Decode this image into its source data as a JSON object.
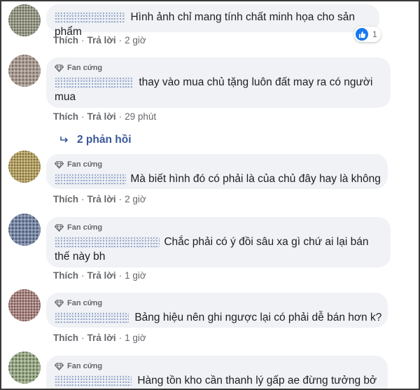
{
  "badge_label": "Fan cứng",
  "action_like": "Thích",
  "action_reply": "Trả lời",
  "separator": "·",
  "colors": {
    "link": "#385898",
    "bubble": "#f0f2f5",
    "meta": "#65676b",
    "like": "#1877f2"
  },
  "comments": [
    {
      "text": "Hình ảnh chỉ mang tính chất minh họa cho sản phẩm",
      "time": "2 giờ",
      "reaction_count": "1"
    },
    {
      "text": "thay vào mua chủ tặng luôn đất may ra có người mua",
      "time": "29 phút",
      "replies": "2 phản hồi"
    },
    {
      "text": "Mà biết hình đó có phải là của chủ đây hay là không",
      "time": "2 giờ"
    },
    {
      "text": "Chắc phải có ý đồi sâu xa gì chứ ai lại bán thế này bh",
      "time": "1 giờ"
    },
    {
      "text": "Bảng hiệu nên ghi ngược lại có phải dễ bán hơn k?",
      "time": "1 giờ"
    },
    {
      "text": "Hàng tồn kho cần thanh lý gấp ae đừng tưởng bở",
      "time": ""
    }
  ]
}
